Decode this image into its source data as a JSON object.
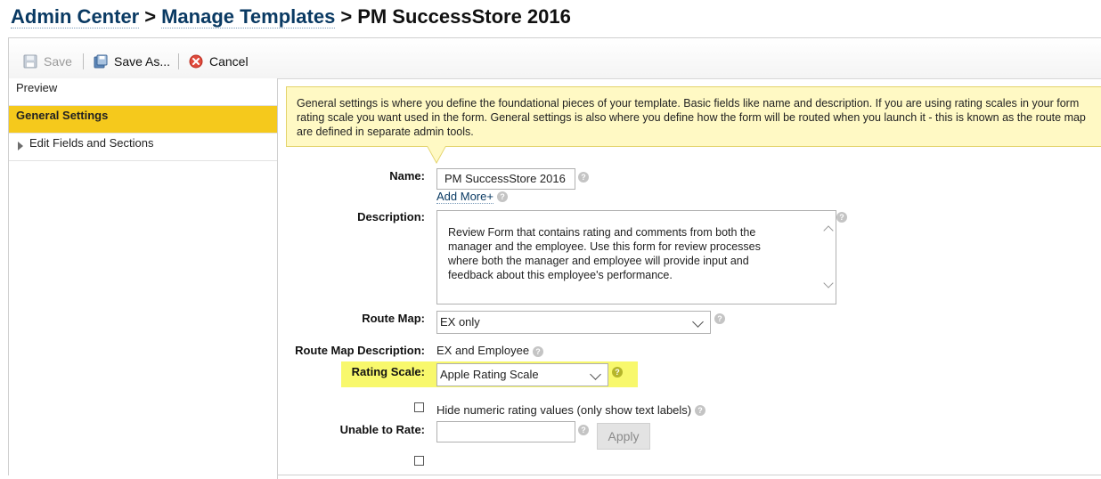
{
  "breadcrumb": {
    "item1": "Admin Center",
    "sep1": ">",
    "item2": "Manage Templates",
    "sep2": ">",
    "current": "PM SuccessStore 2016"
  },
  "toolbar": {
    "save_label": "Save",
    "save_as_label": "Save As...",
    "cancel_label": "Cancel"
  },
  "sidebar": {
    "items": [
      {
        "label": "Preview"
      },
      {
        "label": "General Settings"
      },
      {
        "label": "Edit Fields and Sections"
      }
    ]
  },
  "info": {
    "line1": "General settings is where you define the foundational pieces of your template. Basic fields like name and description. If you are using rating scales in your form",
    "line2": "rating scale you want used in the form. General settings is also where you define how the form will be routed when you launch it - this is known as the route map",
    "line3": "are defined in separate admin tools."
  },
  "form": {
    "name_label": "Name:",
    "name_value": "PM SuccessStore 2016",
    "add_more_label": "Add More+",
    "description_label": "Description:",
    "description_value": "Review Form that contains rating and comments from both the manager and the employee. Use this form for review processes where both the manager and employee will provide input and feedback about this employee's performance.",
    "route_map_label": "Route Map:",
    "route_map_value": "EX only",
    "route_map_desc_label": "Route Map Description:",
    "route_map_desc_value": "EX and Employee",
    "rating_scale_label": "Rating Scale:",
    "rating_scale_value": "Apple Rating Scale",
    "hide_numeric_label": "Hide numeric rating values (only show text labels)",
    "unable_label": "Unable to Rate:",
    "unable_value": "",
    "apply_label": "Apply",
    "help_glyph": "?"
  },
  "colors": {
    "active_nav": "#f5c91c",
    "info_bg": "#fff9c4",
    "highlight": "#f8f86c",
    "link": "#0a3a63"
  }
}
